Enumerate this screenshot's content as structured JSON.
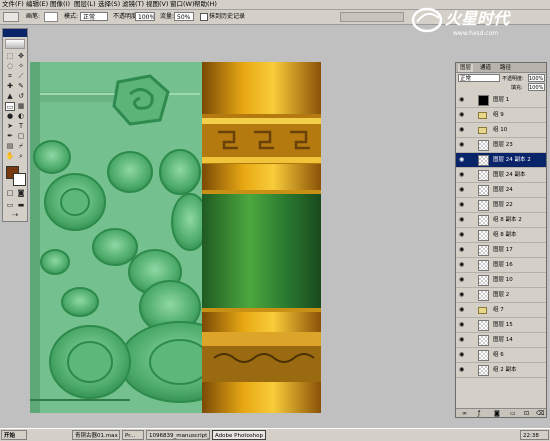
{
  "menu": [
    "文件(F)",
    "编辑(E)",
    "图像(I)",
    "图层(L)",
    "选择(S)",
    "滤镜(T)",
    "视图(V)",
    "窗口(W)",
    "帮助(H)"
  ],
  "options": {
    "brush_label": "画笔:",
    "mode_label": "模式:",
    "mode_value": "正常",
    "opacity_label": "不透明度:",
    "opacity_value": "100%",
    "flow_label": "流量:",
    "flow_value": "50%",
    "history_label": "抹到历史记录"
  },
  "logo": {
    "title": "火星时代",
    "url": "www.hxsd.com"
  },
  "layers_panel": {
    "tabs": [
      "图层",
      "通道",
      "路径"
    ],
    "blend_mode": "正常",
    "opacity_label": "不透明度:",
    "opacity_value": "100%",
    "fill_label": "填充:",
    "fill_value": "100%",
    "rows": [
      {
        "name": "图层 1",
        "kind": "layer",
        "black": true
      },
      {
        "name": "组 9",
        "kind": "group"
      },
      {
        "name": "组 10",
        "kind": "group"
      },
      {
        "name": "图层 23",
        "kind": "layer"
      },
      {
        "name": "图层 24 副本 2",
        "kind": "layer",
        "selected": true
      },
      {
        "name": "图层 24 副本",
        "kind": "layer"
      },
      {
        "name": "图层 24",
        "kind": "layer"
      },
      {
        "name": "图层 22",
        "kind": "layer"
      },
      {
        "name": "组 8 副本 2",
        "kind": "layer"
      },
      {
        "name": "组 8 副本",
        "kind": "layer"
      },
      {
        "name": "图层 17",
        "kind": "layer"
      },
      {
        "name": "图层 16",
        "kind": "layer"
      },
      {
        "name": "图层 10",
        "kind": "layer"
      },
      {
        "name": "图层 2",
        "kind": "layer"
      },
      {
        "name": "组 7",
        "kind": "group"
      },
      {
        "name": "图层 15",
        "kind": "layer"
      },
      {
        "name": "图层 14",
        "kind": "layer"
      },
      {
        "name": "组 6",
        "kind": "layer"
      },
      {
        "name": "组 2 副本",
        "kind": "layer"
      }
    ]
  },
  "taskbar": {
    "start": "开始",
    "tasks": [
      "青铜古器01.max ...",
      "Pr...",
      "1096839_manuscript_00...",
      "Adobe Photoshop"
    ],
    "clock": "22:38"
  },
  "colors": {
    "jade_green": "#6fbe8a",
    "gold": "#c88a12",
    "selection_blue": "#0a246a",
    "foreground": "#7a3a10"
  }
}
